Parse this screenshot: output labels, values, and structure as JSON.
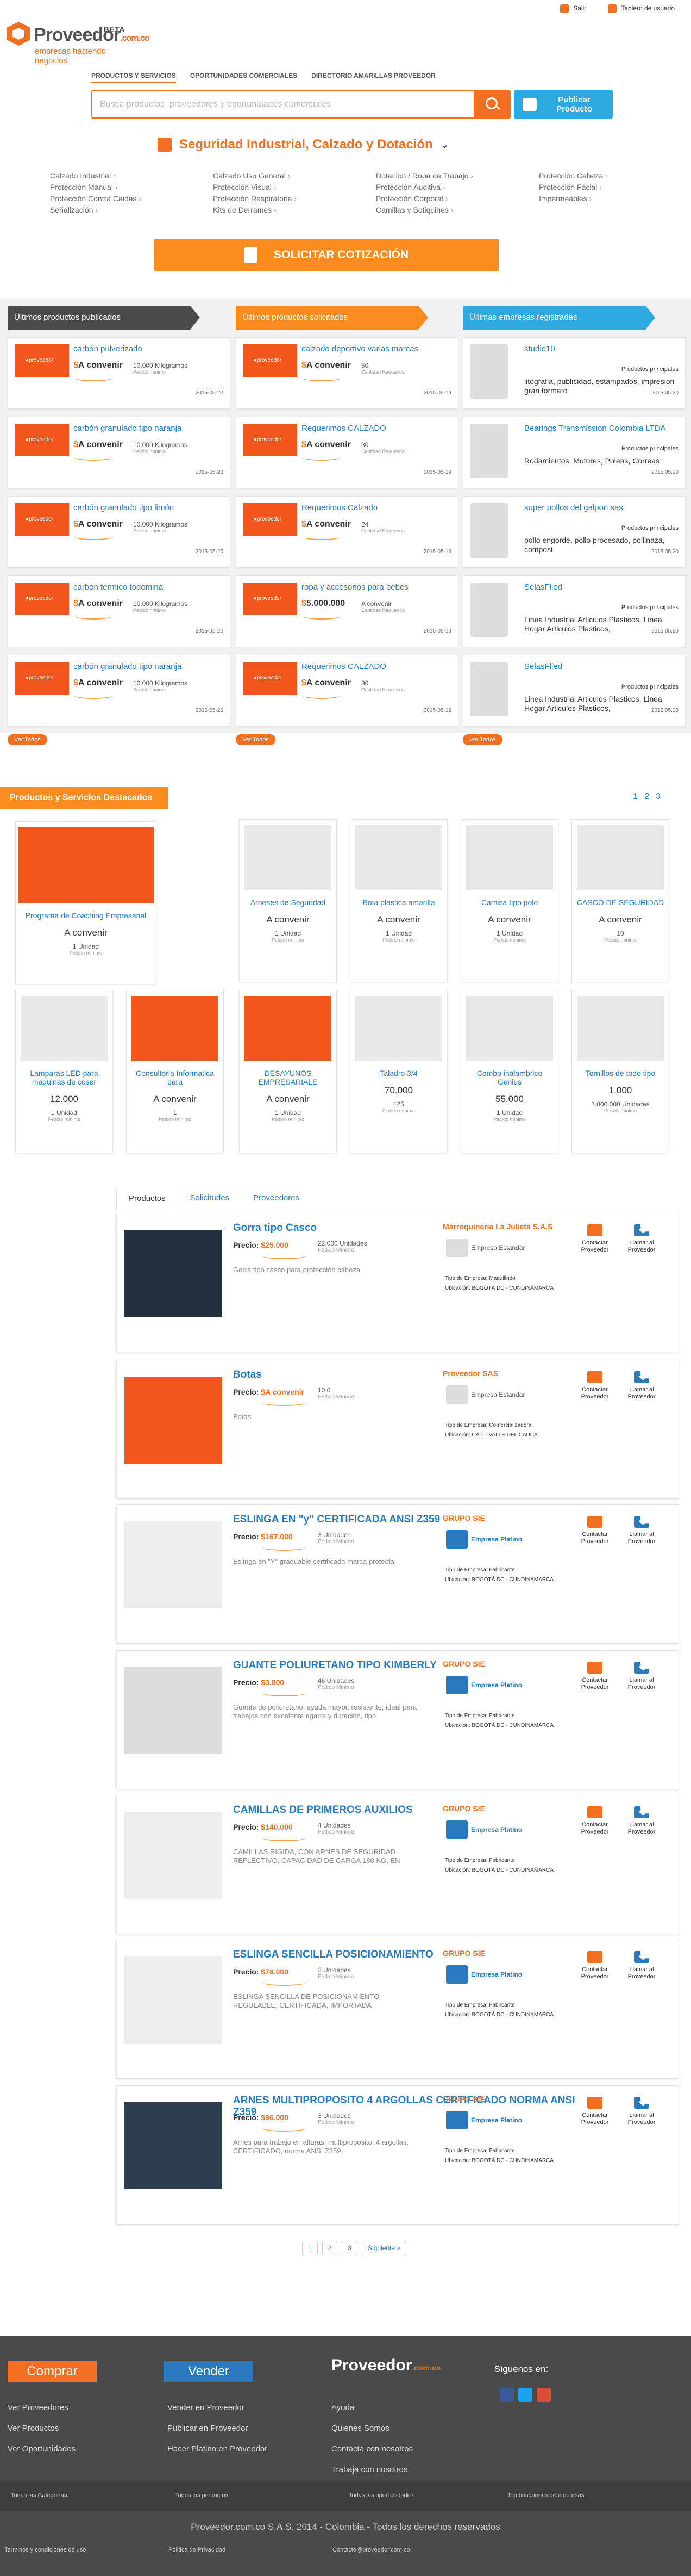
{
  "header": {
    "logo": "Proveedor",
    "logo_suffix": ".com.co",
    "beta": "BETA",
    "tagline": "empresas haciendo negocios",
    "user_links": [
      "Salir",
      "Tablero de usuario"
    ]
  },
  "tabs": [
    "PRODUCTOS Y SERVICIOS",
    "OPORTUNIDADES COMERCIALES",
    "DIRECTORIO AMARILLAS PROVEEDOR"
  ],
  "search": {
    "placeholder": "Busca productos, proveedores y oportunidades comerciales",
    "publish": "Publicar Producto"
  },
  "category": {
    "title": "Seguridad Industrial, Calzado y Dotación",
    "subcategories": [
      "Calzado Industrial",
      "Calzado Uso General",
      "Dotacion / Ropa de Trabajo",
      "Protección Cabeza",
      "Protección Manual",
      "Protección Visual",
      "Protección Auditiva",
      "Protección Facial",
      "Protección Contra Caidas",
      "Protección Respiratoria",
      "Protección Corporal",
      "Impermeables",
      "Señalización",
      "Kits de Derrames",
      "Camillas y Botiquines"
    ]
  },
  "quote_button": "SOLICITAR COTIZACIÓN",
  "columns": {
    "published": {
      "title": "Últimos productos publicados",
      "items": [
        {
          "t": "carbón pulverizado",
          "q": "10.000 Kilogramos",
          "d": "2015-05-20"
        },
        {
          "t": "carbón granulado tipo naranja",
          "q": "10.000 Kilogramos",
          "d": "2015-05-20"
        },
        {
          "t": "carbón granulado tipo limón",
          "q": "10.000 Kilogramos",
          "d": "2015-05-20"
        },
        {
          "t": "carbon termico todomina",
          "q": "10.000 Kilogramos",
          "d": "2015-05-20"
        },
        {
          "t": "carbón granulado tipo naranja",
          "q": "10.000 Kilogramos",
          "d": "2015-05-20"
        }
      ]
    },
    "requested": {
      "title": "Últimos productos solicitados",
      "items": [
        {
          "t": "calzado deportivo varias marcas",
          "q": "50",
          "d": "2015-05-19"
        },
        {
          "t": "Requerimos CALZADO",
          "q": "30",
          "d": "2015-05-19"
        },
        {
          "t": "Requerimos Calzado",
          "q": "24",
          "d": "2015-05-19"
        },
        {
          "t": "ropa y accesorios para bebes",
          "q": "A convenir",
          "d": "2015-05-19",
          "price": "5.000.000"
        },
        {
          "t": "Requerimos CALZADO",
          "q": "30",
          "d": "2015-05-19"
        }
      ]
    },
    "companies": {
      "title": "Últimas empresas registradas",
      "items": [
        {
          "t": "studio10",
          "desc": "litografia, publicidad, estampados, impresion gran formato",
          "d": "2015.05.20"
        },
        {
          "t": "Bearings Transmission Colombia LTDA",
          "desc": "Rodamientos, Motores, Poleas, Correas",
          "d": "2015.05.20"
        },
        {
          "t": "super pollos del galpon sas",
          "desc": "pollo engorde, pollo procesado, pollinaza, compost",
          "d": "2015.05.20"
        },
        {
          "t": "SelasFlied",
          "desc": "Linea Industrial Articulos Plasticos, Linea Hogar Articulos Plasticos,",
          "d": "2015.05.20"
        },
        {
          "t": "SelasFlied",
          "desc": "Linea Industrial Articulos Plasticos, Linea Hogar Articulos Plasticos,",
          "d": "2015.05.20"
        }
      ]
    },
    "price_label": "A convenir",
    "qty_sub": "Pedido mínimo",
    "req_sub": "Cantidad Requerida",
    "pp": "Productos principales",
    "see_all": "Ver Todos"
  },
  "featured": {
    "title": "Productos y Servicios Destacados",
    "pages": [
      "1",
      "2",
      "3"
    ],
    "cards": [
      {
        "n": "Programa de Coaching Empresarial",
        "pr": "A convenir",
        "u": "1 Unidad"
      },
      {
        "n": "Arneses de Seguridad",
        "pr": "A convenir",
        "u": "1 Unidad"
      },
      {
        "n": "Bota plastica amarilla",
        "pr": "A convenir",
        "u": "1 Unidad"
      },
      {
        "n": "Camisa tipo polo",
        "pr": "A convenir",
        "u": "1 Unidad"
      },
      {
        "n": "CASCO DE SEGURIDAD",
        "pr": "A convenir",
        "u": "10"
      },
      {
        "n": "Lamparas LED para maquinas de coser",
        "pr": "12.000",
        "u": "1 Unidad"
      },
      {
        "n": "Consultoria Informatica para",
        "pr": "A convenir",
        "u": "1"
      },
      {
        "n": "DESAYUNOS EMPRESARIALE",
        "pr": "A convenir",
        "u": "1 Unidad"
      },
      {
        "n": "Taladro 3/4",
        "pr": "70.000",
        "u": "125"
      },
      {
        "n": "Combo inalambrico Genius",
        "pr": "55.000",
        "u": "1 Unidad"
      },
      {
        "n": "Tornillos de todo tipo",
        "pr": "1.000",
        "u": "1.000.000 Unidades"
      }
    ]
  },
  "list": {
    "tabs": [
      "Productos",
      "Solicitudes",
      "Proveedores"
    ],
    "contact": "Contactar Proveedor",
    "call": "Llamar al Proveedor",
    "rows": [
      {
        "ti": "Gorra tipo Casco",
        "pr": "25.000",
        "u": "22.000 Unidades",
        "ds": "Gorra tipo casco para protección cabeza",
        "co": "Marroquineria La Julieta S.A.S",
        "pl": "Empresa Estandar",
        "ty": "Tipo de Empresa: Maquilindo",
        "ub": "Ubicación: BOGOTÁ DC - CUNDINAMARCA"
      },
      {
        "ti": "Botas",
        "pr": "A convenir",
        "u": "10.0",
        "ds": "Botas",
        "co": "Proveedor SAS",
        "pl": "Empresa Estandar",
        "ty": "Tipo de Empresa: Comercializadora",
        "ub": "Ubicación: CALI - VALLE DEL CAUCA"
      },
      {
        "ti": "ESLINGA EN \"y\" CERTIFICADA ANSI Z359",
        "pr": "167.000",
        "u": "3 Unidades",
        "ds": "Eslinga en \"Y\" graduable certificada marca protecta",
        "co": "GRUPO SIE",
        "pl": "Empresa Platino",
        "ty": "Tipo de Empresa: Fabricante",
        "ub": "Ubicación: BOGOTÁ DC - CUNDINAMARCA"
      },
      {
        "ti": "GUANTE POLIURETANO TIPO KIMBERLY",
        "pr": "3.800",
        "u": "46 Unidades",
        "ds": "Guante de poliuretano, ayuda mayor, resistente, ideal para trabajos con excelente agarre y duración, tipo",
        "co": "GRUPO SIE",
        "pl": "Empresa Platino",
        "ty": "Tipo de Empresa: Fabricante",
        "ub": "Ubicación: BOGOTÁ DC - CUNDINAMARCA"
      },
      {
        "ti": "CAMILLAS DE PRIMEROS AUXILIOS",
        "pr": "140.000",
        "u": "4 Unidades",
        "ds": "CAMILLAS RIGIDA, CON ARNES DE SEGURIDAD REFLECTIVO, CAPACIDAD DE CARGA 180 KG, EN",
        "co": "GRUPO SIE",
        "pl": "Empresa Platino",
        "ty": "Tipo de Empresa: Fabricante",
        "ub": "Ubicación: BOGOTÁ DC - CUNDINAMARCA"
      },
      {
        "ti": "ESLINGA SENCILLA POSICIONAMIENTO",
        "pr": "78.000",
        "u": "3 Unidades",
        "ds": "ESLINGA SENCILLA DE POSICIONAMIENTO REGULABLE, CERTIFICADA, IMPORTADA",
        "co": "GRUPO SIE",
        "pl": "Empresa Platino",
        "ty": "Tipo de Empresa: Fabricante",
        "ub": "Ubicación: BOGOTÁ DC - CUNDINAMARCA"
      },
      {
        "ti": "ARNES MULTIPROPOSITO 4 ARGOLLAS CERTIFICADO NORMA ANSI Z359",
        "pr": "96.000",
        "u": "3 Unidades",
        "ds": "Arnes para trabajo en alturas, multiproposito, 4 argollas, CERTIFICADO, norma ANSI Z359",
        "co": "GRUPO SIE",
        "pl": "Empresa Platino",
        "ty": "Tipo de Empresa: Fabricante",
        "ub": "Ubicación: BOGOTÁ DC - CUNDINAMARCA"
      }
    ],
    "price_label": "Precio:",
    "min": "Pedido Mínimo",
    "pager": [
      "1",
      "2",
      "3",
      "Siguiente »"
    ]
  },
  "footer": {
    "comprar": "Comprar",
    "vender": "Vender",
    "siguenos": "Siguenos en:",
    "c1": [
      "Ver Proveedores",
      "Ver Productos",
      "Ver Oportunidades"
    ],
    "c2": [
      "Vender en Proveedor",
      "Publicar en Proveedor",
      "Hacer Platino en Proveedor"
    ],
    "c3": [
      "Ayuda",
      "Quienes Somos",
      "Contacta con nosotros",
      "Trabaja con nosotros"
    ],
    "bar": [
      "Todas las Categorías",
      "Todos los productos",
      "Todas las oportunidades",
      "Top busquedas de empresas"
    ],
    "copy": "Proveedor.com.co S.A.S. 2014 - Colombia - Todos los derechos reservados",
    "bottom": [
      "Terminos y condiciones de uso",
      "Politica de Privacidad",
      "Contacto@proveedor.com.co"
    ]
  }
}
